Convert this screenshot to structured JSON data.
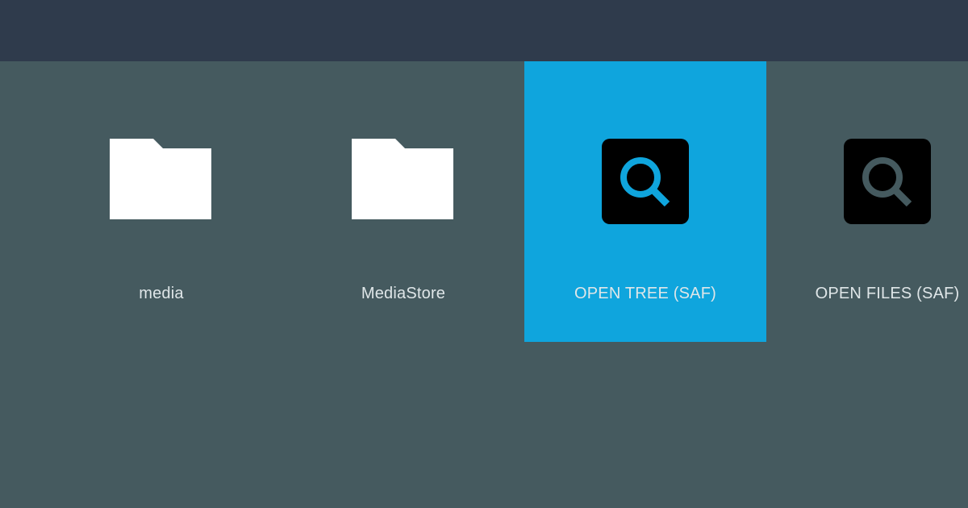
{
  "colors": {
    "background": "#455a5f",
    "topbar": "#2f3b4c",
    "selected_tile": "#0fa5dd",
    "label_text": "#dfe6e8",
    "folder_icon": "#ffffff",
    "search_icon_box": "#000000",
    "search_icon_selected": "#0fa5dd",
    "search_icon_default": "#455a5f"
  },
  "tiles": [
    {
      "label": "media",
      "icon": "folder-icon",
      "selected": false
    },
    {
      "label": "MediaStore",
      "icon": "folder-icon",
      "selected": false
    },
    {
      "label": "OPEN TREE (SAF)",
      "icon": "search-icon",
      "selected": true
    },
    {
      "label": "OPEN FILES (SAF)",
      "icon": "search-icon",
      "selected": false
    }
  ]
}
